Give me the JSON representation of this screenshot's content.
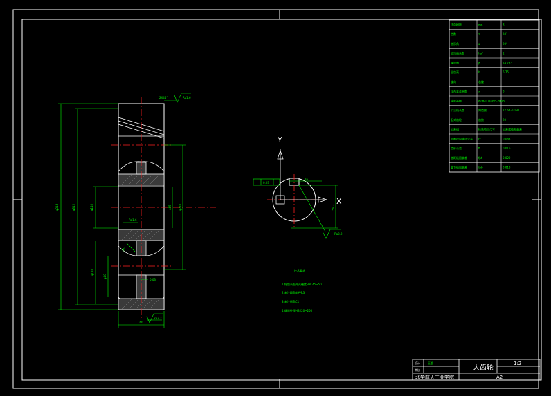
{
  "title_block": {
    "part_name": "大齿轮",
    "scale": "1:2",
    "designer_label": "设计",
    "designer_name": "王超",
    "checker_label": "审核",
    "school": "北华航天工业学院",
    "sheet": "A2"
  },
  "param_table": [
    [
      "法向模数",
      "mn",
      "3"
    ],
    [
      "齿数",
      "z",
      "101"
    ],
    [
      "齿形角",
      "α",
      "20°"
    ],
    [
      "齿顶高系数",
      "ha*",
      "1"
    ],
    [
      "螺旋角",
      "β",
      "14.78°"
    ],
    [
      "全齿高",
      "h",
      "6.75"
    ],
    [
      "旋向",
      "右旋",
      ""
    ],
    [
      "径向变位系数",
      "x",
      "0"
    ],
    [
      "精度等级",
      "8GB/T 10095-2008",
      ""
    ],
    [
      "公法线长度",
      "跨齿数",
      "77.64-0.190"
    ],
    [
      "配对齿轮",
      "齿数",
      "20"
    ],
    [
      "公差组",
      "检验项目代号",
      "公差或极限偏差"
    ],
    [
      "齿圈径向跳动公差",
      "Fr",
      "0.063"
    ],
    [
      "齿形公差",
      "ff",
      "0.016"
    ],
    [
      "齿距极限偏差",
      "fpt",
      "0.020"
    ],
    [
      "基节极限偏差",
      "fpb",
      "0.018"
    ]
  ],
  "notes": {
    "heading": "技术要求",
    "items": [
      "1.轮齿表面淬火硬度HRC45~50",
      "2.未注圆角半径R3",
      "3.未注倒角C1",
      "4.调质处理HB220~250"
    ]
  },
  "dims": {
    "outer_dia": "φ318",
    "pitch_dia": "φ312",
    "hub_dia": "φ140",
    "bore_dia": "φ55",
    "rim_dia": "φ270",
    "web_dia": "φ170",
    "web_inner": "φ80",
    "width": "60",
    "roughness_top": "Ra1.6",
    "roughness_side": "Ra3.2",
    "roughness_hub": "Ra1.6",
    "roughness_bottom": "Ra3.2",
    "chamfer": "2X45°",
    "keyway_tol": "0.03",
    "key_width": "16",
    "key_depth": "59.3",
    "key_rough": "Ra3.2",
    "fillet": "R5"
  },
  "axes": {
    "y": "Y",
    "x": "X"
  }
}
